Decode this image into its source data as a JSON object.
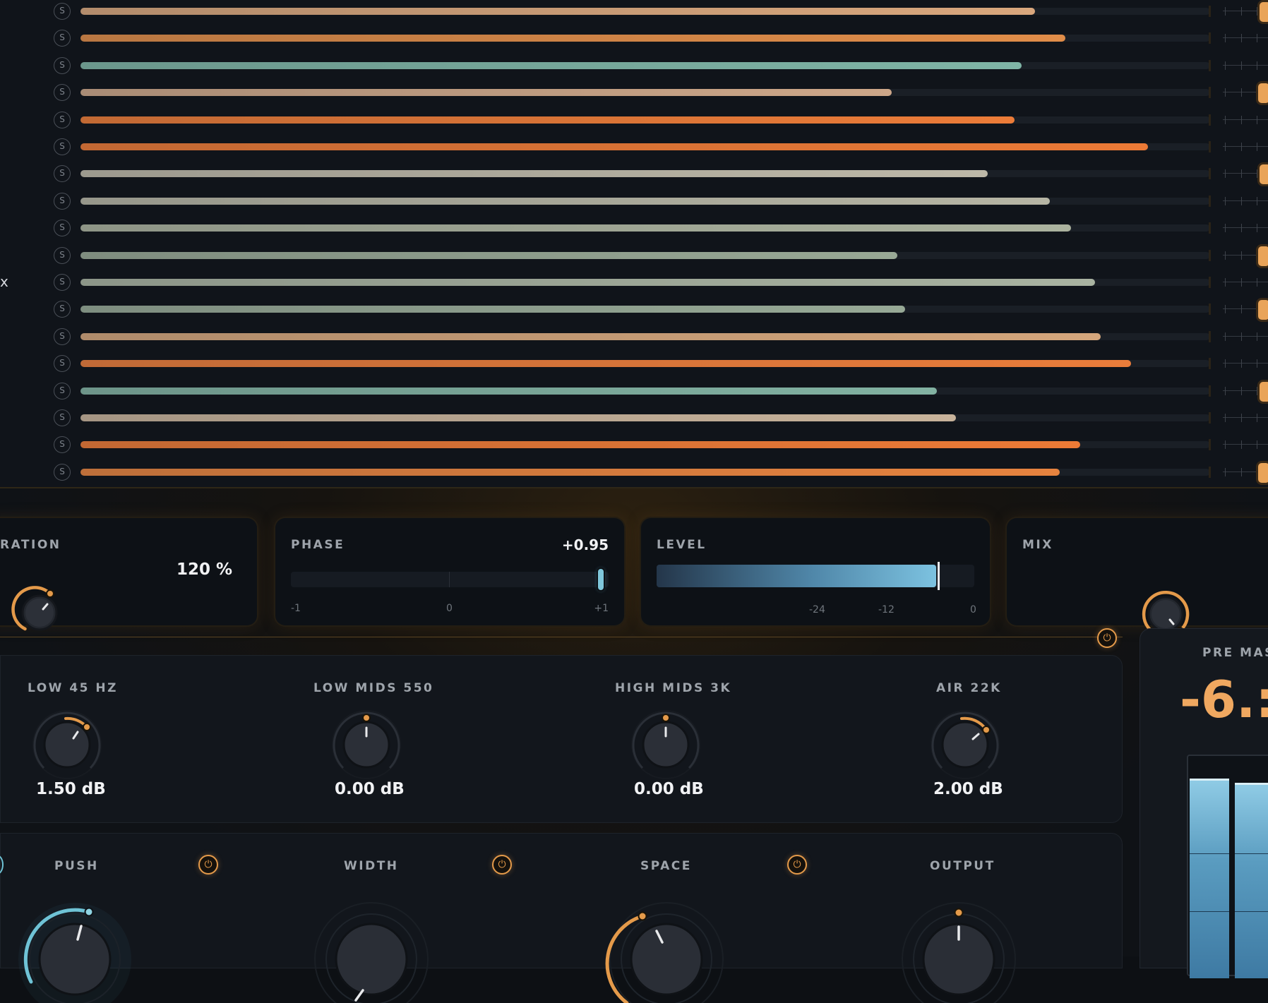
{
  "tracks": [
    {
      "solo": "S",
      "fill": 0.845,
      "color": "#d9a77d",
      "handle": true
    },
    {
      "solo": "S",
      "fill": 0.872,
      "color": "#e08d49",
      "handle": false
    },
    {
      "solo": "S",
      "fill": 0.833,
      "color": "#7fb5a6",
      "handle": false
    },
    {
      "solo": "S",
      "fill": 0.718,
      "color": "#cda789",
      "handle": true
    },
    {
      "solo": "S",
      "fill": 0.827,
      "color": "#ec7c38",
      "handle": false
    },
    {
      "solo": "S",
      "fill": 0.945,
      "color": "#ec7a36",
      "handle": false
    },
    {
      "solo": "S",
      "fill": 0.803,
      "color": "#bdb8a8",
      "handle": true
    },
    {
      "solo": "S",
      "fill": 0.858,
      "color": "#b6b5a4",
      "handle": false
    },
    {
      "solo": "S",
      "fill": 0.877,
      "color": "#abb29e",
      "handle": false
    },
    {
      "solo": "S",
      "fill": 0.723,
      "color": "#98a895",
      "handle": true
    },
    {
      "solo": "S",
      "fill": 0.898,
      "color": "#a9b3a1",
      "handle": false
    },
    {
      "solo": "S",
      "fill": 0.73,
      "color": "#97a996",
      "handle": true
    },
    {
      "solo": "S",
      "fill": 0.903,
      "color": "#d4a67c",
      "handle": false
    },
    {
      "solo": "S",
      "fill": 0.93,
      "color": "#ea7d3b",
      "handle": false
    },
    {
      "solo": "S",
      "fill": 0.758,
      "color": "#82b2a2",
      "handle": true
    },
    {
      "solo": "S",
      "fill": 0.775,
      "color": "#c8b39b",
      "handle": false
    },
    {
      "solo": "S",
      "fill": 0.885,
      "color": "#ec7a36",
      "handle": false
    },
    {
      "solo": "S",
      "fill": 0.867,
      "color": "#e6833f",
      "handle": true
    }
  ],
  "cut_label": "x",
  "saturation": {
    "label": "RATION",
    "value": "120 %"
  },
  "phase": {
    "label": "PHASE",
    "value": "+0.95",
    "amount": 0.95,
    "scale_min": "-1",
    "scale_mid": "0",
    "scale_max": "+1"
  },
  "level": {
    "label": "LEVEL",
    "amount": 0.88,
    "ticks": [
      "-24",
      "-12",
      "0"
    ]
  },
  "mix": {
    "label": "MIX"
  },
  "eq": [
    {
      "label": "LOW 45 HZ",
      "value": "1.50 dB"
    },
    {
      "label": "LOW MIDS 550",
      "value": "0.00 dB"
    },
    {
      "label": "HIGH MIDS 3K",
      "value": "0.00 dB"
    },
    {
      "label": "AIR 22K",
      "value": "2.00 dB"
    }
  ],
  "bottom": [
    {
      "label": "PUSH"
    },
    {
      "label": "WIDTH"
    },
    {
      "label": "SPACE"
    },
    {
      "label": "OUTPUT"
    }
  ],
  "premaster": {
    "label": "PRE MAS",
    "value": "-6.:"
  },
  "colors": {
    "accent": "#e49a4a",
    "cyan": "#6fc3d6",
    "meter": "#6aaed0"
  }
}
